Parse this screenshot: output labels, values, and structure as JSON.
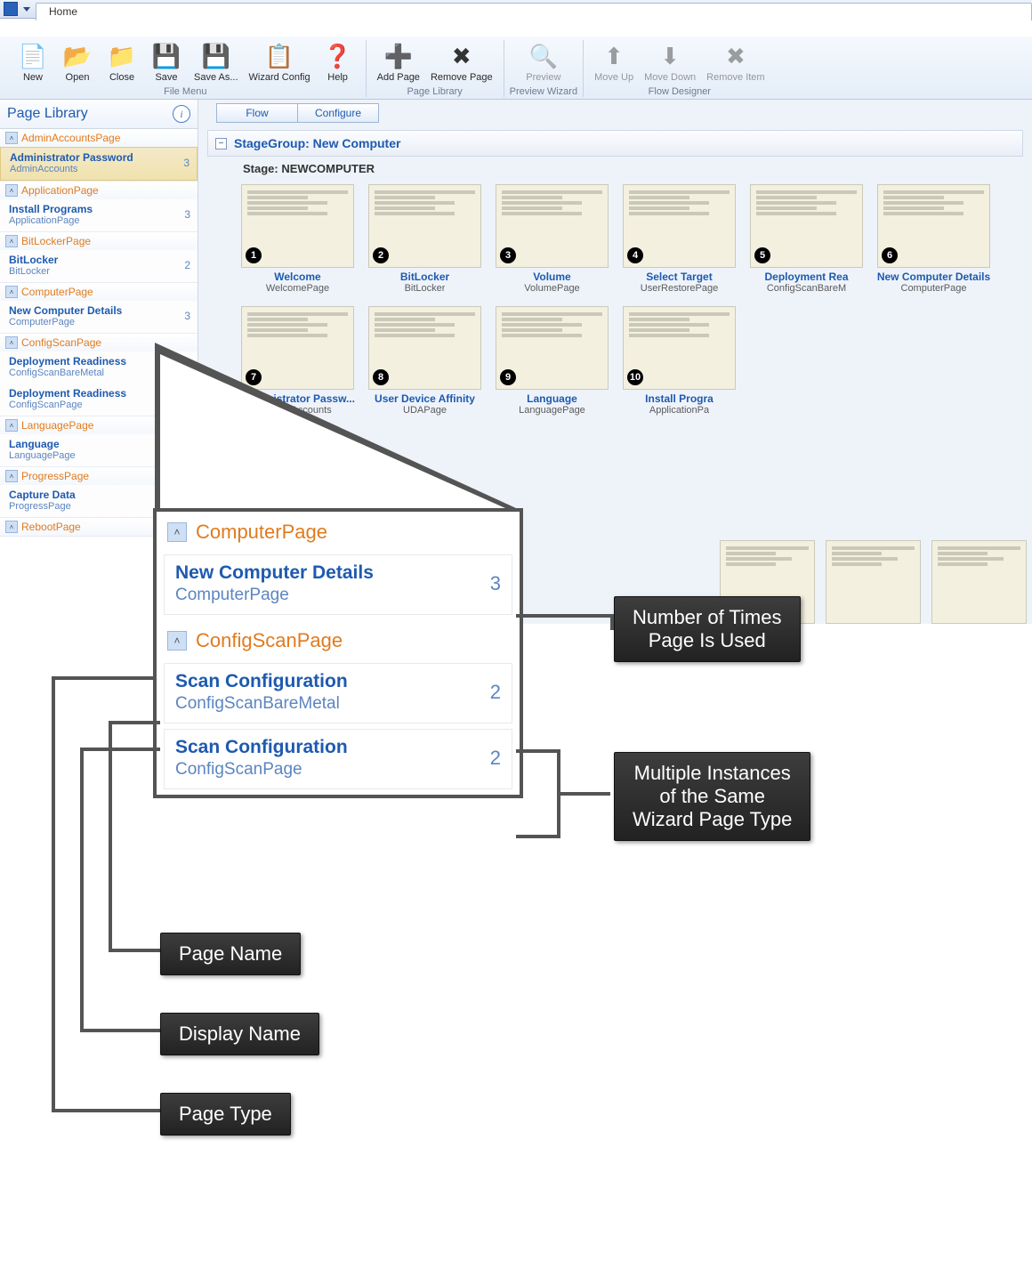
{
  "titlebar": {
    "home_tab": "Home"
  },
  "ribbon": {
    "groups": [
      {
        "label": "File Menu",
        "buttons": [
          {
            "name": "new",
            "label": "New",
            "icon": "📄"
          },
          {
            "name": "open",
            "label": "Open",
            "icon": "📂"
          },
          {
            "name": "close",
            "label": "Close",
            "icon": "📁"
          },
          {
            "name": "save",
            "label": "Save",
            "icon": "💾"
          },
          {
            "name": "save-as",
            "label": "Save\nAs...",
            "icon": "💾"
          },
          {
            "name": "wizard-config",
            "label": "Wizard\nConfig",
            "icon": "📋"
          },
          {
            "name": "help",
            "label": "Help",
            "icon": "❓"
          }
        ]
      },
      {
        "label": "Page Library",
        "buttons": [
          {
            "name": "add-page",
            "label": "Add\nPage",
            "icon": "➕"
          },
          {
            "name": "remove-page",
            "label": "Remove\nPage",
            "icon": "✖"
          }
        ]
      },
      {
        "label": "Preview Wizard",
        "buttons": [
          {
            "name": "preview",
            "label": "Preview",
            "icon": "🔍",
            "disabled": true
          }
        ]
      },
      {
        "label": "Flow Designer",
        "buttons": [
          {
            "name": "move-up",
            "label": "Move\nUp",
            "icon": "⬆",
            "disabled": true
          },
          {
            "name": "move-down",
            "label": "Move\nDown",
            "icon": "⬇",
            "disabled": true
          },
          {
            "name": "remove-item",
            "label": "Remove\nItem",
            "icon": "✖",
            "disabled": true
          }
        ]
      }
    ]
  },
  "sidebar": {
    "title": "Page Library",
    "cats": [
      {
        "head": "AdminAccountsPage",
        "items": [
          {
            "pn": "Administrator Password",
            "dn": "AdminAccounts",
            "cnt": "3",
            "sel": true
          }
        ]
      },
      {
        "head": "ApplicationPage",
        "items": [
          {
            "pn": "Install Programs",
            "dn": "ApplicationPage",
            "cnt": "3"
          }
        ]
      },
      {
        "head": "BitLockerPage",
        "items": [
          {
            "pn": "BitLocker",
            "dn": "BitLocker",
            "cnt": "2"
          }
        ]
      },
      {
        "head": "ComputerPage",
        "items": [
          {
            "pn": "New Computer Details",
            "dn": "ComputerPage",
            "cnt": "3"
          }
        ]
      },
      {
        "head": "ConfigScanPage",
        "items": [
          {
            "pn": "Deployment Readiness",
            "dn": "ConfigScanBareMetal",
            "cnt": ""
          },
          {
            "pn": "Deployment Readiness",
            "dn": "ConfigScanPage",
            "cnt": ""
          }
        ]
      },
      {
        "head": "LanguagePage",
        "items": [
          {
            "pn": "Language",
            "dn": "LanguagePage",
            "cnt": ""
          }
        ]
      },
      {
        "head": "ProgressPage",
        "items": [
          {
            "pn": "Capture Data",
            "dn": "ProgressPage",
            "cnt": ""
          }
        ]
      },
      {
        "head": "RebootPage",
        "items": []
      }
    ]
  },
  "main": {
    "tabs": [
      "Flow",
      "Configure"
    ],
    "stagegroup": "StageGroup: New Computer",
    "stage": "Stage: NEWCOMPUTER",
    "thumbs": [
      {
        "n": "1",
        "t": "Welcome",
        "s": "WelcomePage"
      },
      {
        "n": "2",
        "t": "BitLocker",
        "s": "BitLocker"
      },
      {
        "n": "3",
        "t": "Volume",
        "s": "VolumePage"
      },
      {
        "n": "4",
        "t": "Select Target",
        "s": "UserRestorePage"
      },
      {
        "n": "5",
        "t": "Deployment Rea",
        "s": "ConfigScanBareM"
      },
      {
        "n": "6",
        "t": "New Computer Details",
        "s": "ComputerPage"
      },
      {
        "n": "7",
        "t": "Administrator Passw...",
        "s": "AdminAccounts"
      },
      {
        "n": "8",
        "t": "User Device Affinity",
        "s": "UDAPage"
      },
      {
        "n": "9",
        "t": "Language",
        "s": "LanguagePage"
      },
      {
        "n": "10",
        "t": "Install Progra",
        "s": "ApplicationPa"
      }
    ]
  },
  "zoom": {
    "c1_head": "ComputerPage",
    "c1_pn": "New Computer Details",
    "c1_dn": "ComputerPage",
    "c1_cnt": "3",
    "c2_head": "ConfigScanPage",
    "c2a_pn": "Scan Configuration",
    "c2a_dn": "ConfigScanBareMetal",
    "c2a_cnt": "2",
    "c2b_pn": "Scan Configuration",
    "c2b_dn": "ConfigScanPage",
    "c2b_cnt": "2"
  },
  "callouts": {
    "count": "Number of Times\nPage Is Used",
    "multi": "Multiple Instances\nof the Same\nWizard Page Type",
    "pagename": "Page Name",
    "displayname": "Display Name",
    "pagetype": "Page Type"
  }
}
